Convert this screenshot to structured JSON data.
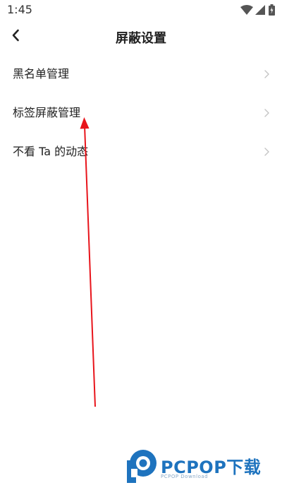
{
  "status_bar": {
    "time": "1:45",
    "icons": [
      "wifi-icon",
      "cellular-signal-icon",
      "battery-icon"
    ]
  },
  "header": {
    "back_icon": "chevron-left-icon",
    "title": "屏蔽设置"
  },
  "menu": {
    "items": [
      {
        "label": "黑名单管理",
        "icon": "chevron-right-icon"
      },
      {
        "label": "标签屏蔽管理",
        "icon": "chevron-right-icon"
      },
      {
        "label": "不看 Ta 的动态",
        "icon": "chevron-right-icon"
      }
    ]
  },
  "annotation": {
    "arrow_color": "#e8141b"
  },
  "watermark": {
    "brand": "PCPOP下载",
    "subtitle": "PCPOP Download",
    "color": "#1e73be"
  }
}
